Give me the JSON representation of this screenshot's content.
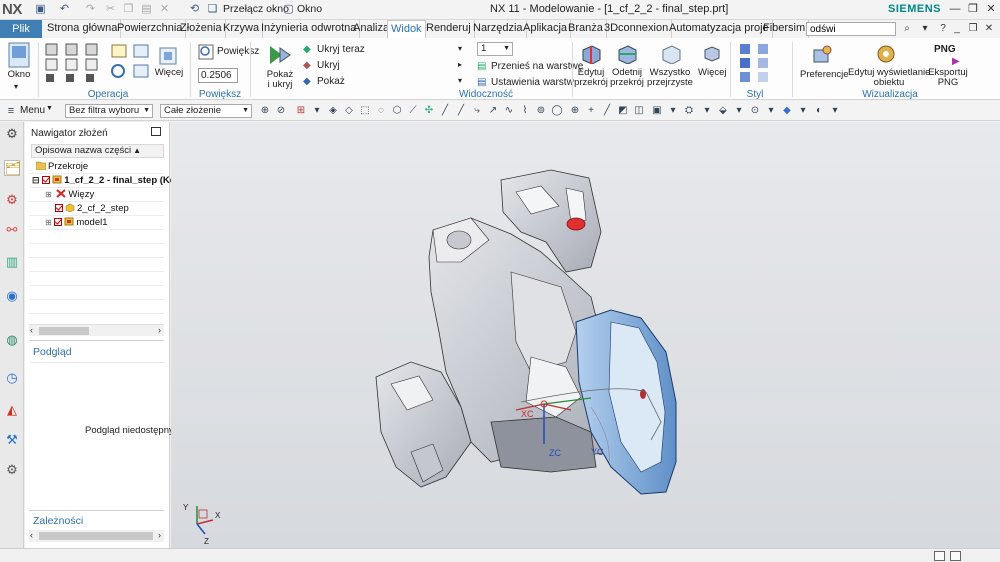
{
  "titlebar": {
    "logo": "NX",
    "switch_window_label": "Przełącz okno",
    "window_label": "Okno",
    "title": "NX 11 - Modelowanie - [1_cf_2_2 - final_step.prt]",
    "brand": "SIEMENS"
  },
  "tabs": {
    "file": "Plik",
    "items": [
      "Strona główna",
      "Powierzchnia",
      "Złożenia",
      "Krzywa",
      "Inżynieria odwrotna",
      "Analiza",
      "Widok",
      "Renderuj",
      "Narzędzia",
      "Aplikacja",
      "Branża",
      "3Dconnexion",
      "Automatyzacja proje",
      "Fibersim"
    ],
    "active": "Widok",
    "search_value": "odświ"
  },
  "ribbon": {
    "okno_label": "Okno",
    "operacja_group": "Operacja",
    "wiecej1": "Więcej",
    "powieksz_btn": "Powiększ",
    "zoom_value": "0.2506",
    "powieksz_group": "Powiększ",
    "pokaz_i_ukryj": "Pokaż\ni ukryj",
    "ukryj_teraz": "Ukryj teraz",
    "ukryj": "Ukryj",
    "pokaz": "Pokaż",
    "layer_value": "1",
    "przenies": "Przenieś na warstwę",
    "ustawienia_warstw": "Ustawienia warstw",
    "widocznosc_group": "Widoczność",
    "edytuj_przekroj": "Edytuj\nprzekrój",
    "odetnij_przekroj": "Odetnij\nprzekrój",
    "wszystko_przejrzyste": "Wszystko\nprzejrzyste",
    "wiecej2": "Więcej",
    "styl_group": "Styl",
    "preferencje": "Preferencje",
    "edytuj_wyswietlanie": "Edytuj wyświetlanie\nobiektu",
    "eksportuj_png": "Eksportuj\nPNG",
    "png_badge": "PNG",
    "wizualizacja_group": "Wizualizacja"
  },
  "selbar": {
    "menu": "Menu",
    "filter": "Bez filtra wyboru",
    "scope": "Całe złożenie"
  },
  "navigator": {
    "title": "Nawigator złożeń",
    "column": "Opisowa nazwa części",
    "rows": [
      {
        "label": "Przekroje"
      },
      {
        "label": "1_cf_2_2 - final_step (Ko"
      },
      {
        "label": "Więzy"
      },
      {
        "label": "2_cf_2_step"
      },
      {
        "label": "model1"
      }
    ],
    "preview_header": "Podgląd",
    "preview_text": "Podgląd niedostępny",
    "dependencies_header": "Zależności"
  },
  "graphics": {
    "axis_x": "XC",
    "axis_z": "ZC",
    "axis_y": "YC",
    "triad_y": "Y",
    "triad_x": "X",
    "triad_z": "Z"
  },
  "colors": {
    "accent": "#3f7fb3",
    "brand": "#00868b",
    "part_grey": "#c9ccd3",
    "part_blue": "#8fb4dc"
  }
}
